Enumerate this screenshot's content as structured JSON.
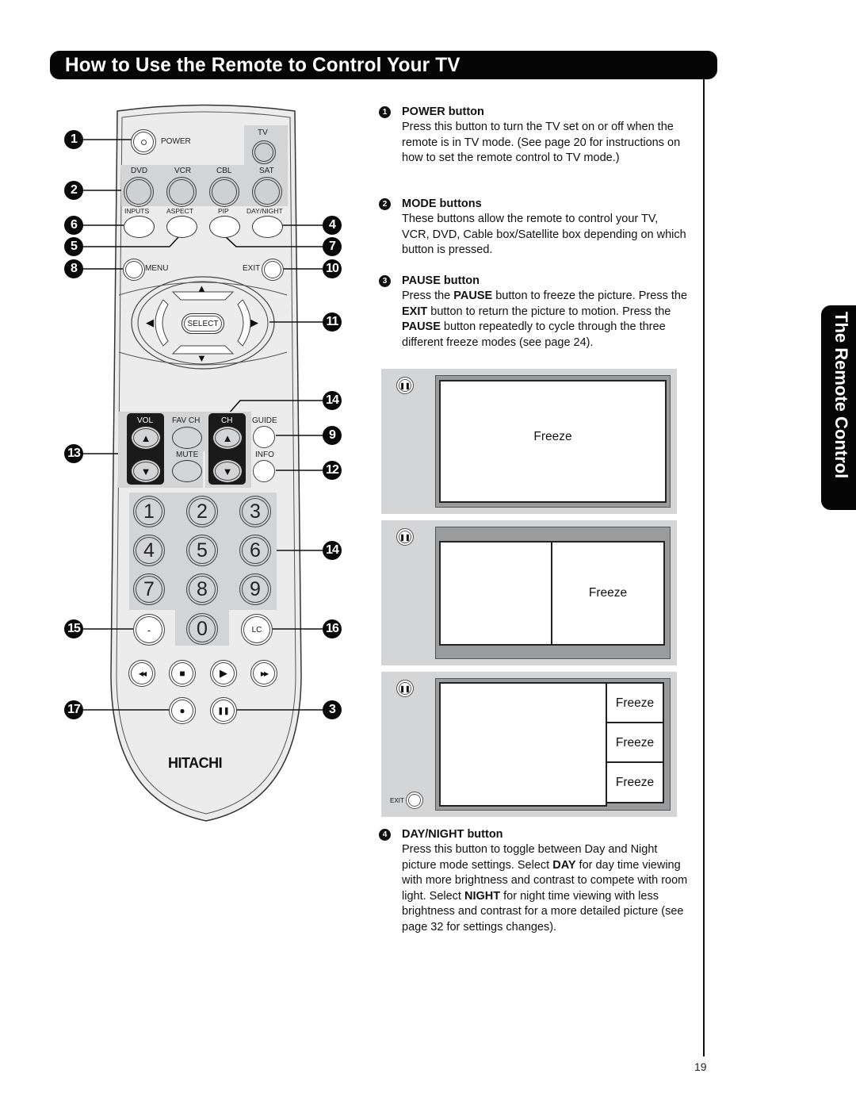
{
  "header": {
    "title": "How to Use the Remote to Control Your TV"
  },
  "side_tab": {
    "label": "The Remote Control"
  },
  "page_number": "19",
  "remote": {
    "brand": "HITACHI",
    "labels": {
      "power": "POWER",
      "tv": "TV",
      "dvd": "DVD",
      "vcr": "VCR",
      "cbl": "CBL",
      "sat": "SAT",
      "inputs": "INPUTS",
      "aspect": "ASPECT",
      "pip": "PIP",
      "day_night": "DAY/NIGHT",
      "menu": "MENU",
      "exit": "EXIT",
      "select": "SELECT",
      "vol": "VOL",
      "fav_ch": "FAV CH",
      "ch": "CH",
      "guide": "GUIDE",
      "mute": "MUTE",
      "info": "INFO",
      "dash": "-",
      "lc": "LC"
    },
    "number_keys": [
      "1",
      "2",
      "3",
      "4",
      "5",
      "6",
      "7",
      "8",
      "9",
      "0"
    ],
    "transport_icons": [
      "rewind-icon",
      "stop-icon",
      "play-icon",
      "fast-forward-icon",
      "record-icon",
      "pause-icon"
    ],
    "glyphs": {
      "up": "▲",
      "down": "▼",
      "left": "◀",
      "right": "▶",
      "rewind": "◀◀",
      "stop": "■",
      "play": "▶",
      "ff": "▶▶",
      "record": "●",
      "pause": "❚❚"
    },
    "callouts": {
      "c1": "1",
      "c2": "2",
      "c6": "6",
      "c4": "4",
      "c5": "5",
      "c7": "7",
      "c8": "8",
      "c10": "10",
      "c11": "11",
      "c14a": "14",
      "c9": "9",
      "c13": "13",
      "c12": "12",
      "c14b": "14",
      "c15": "15",
      "c16": "16",
      "c17": "17",
      "c3": "3"
    }
  },
  "sections": [
    {
      "num": "1",
      "title": "POWER button",
      "body": "Press this button to turn the TV set on or off when the remote is in TV mode. (See page 20 for instructions on how to set the remote control to TV mode.)"
    },
    {
      "num": "2",
      "title": "MODE buttons",
      "body": "These buttons allow the remote to control your TV, VCR, DVD, Cable box/Satellite box depending on which button is pressed."
    },
    {
      "num": "3",
      "title": "PAUSE button",
      "body_parts": [
        "Press the ",
        "PAUSE",
        " button to freeze the picture. Press the ",
        "EXIT",
        " button to return the picture to motion. Press the ",
        "PAUSE",
        " button repeatedly to cycle through the three different freeze modes (see page 24)."
      ]
    },
    {
      "num": "4",
      "title": "DAY/NIGHT button",
      "body_parts": [
        "Press this button to toggle between Day and Night picture mode settings. Select ",
        "DAY",
        " for day time viewing with more brightness and contrast to compete with room light. Select ",
        "NIGHT",
        " for night time viewing with less brightness and contrast for a more detailed picture (see page 32 for settings changes)."
      ]
    }
  ],
  "freeze_panels": {
    "freeze_label": "Freeze",
    "exit_label": "EXIT",
    "pause_glyph": "❚❚"
  }
}
